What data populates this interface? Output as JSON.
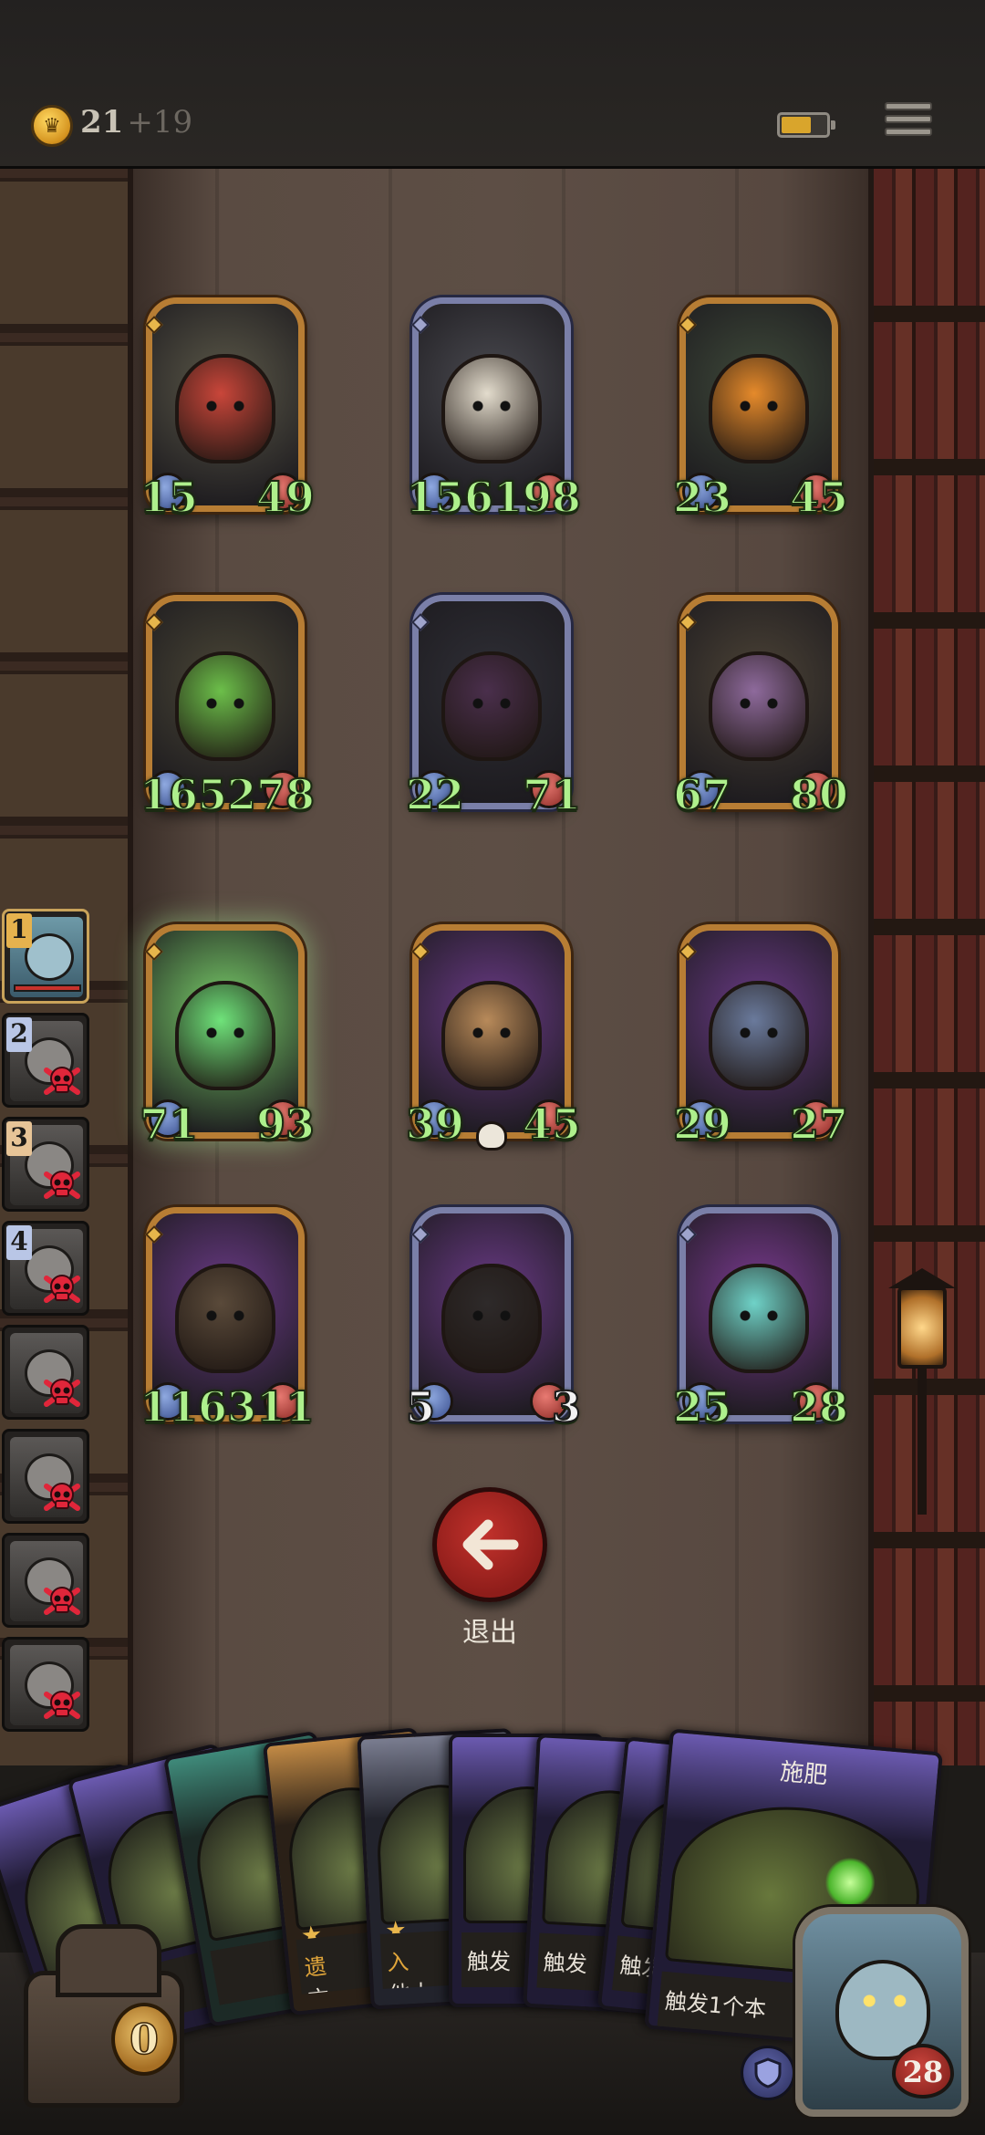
{
  "header": {
    "coins": "21",
    "coins_bonus": "+19",
    "coin_icon": "crown-coin-icon",
    "battery_icon": "battery-icon",
    "menu_icon": "hamburger-menu-icon"
  },
  "board": {
    "units": [
      {
        "id": "tomato-imp",
        "frame": "gold",
        "attack": "15",
        "health": "49",
        "color": "#c9463a",
        "bg": "#5b5848"
      },
      {
        "id": "pumpkin-scarecrow-duo",
        "frame": "silver",
        "attack": "156",
        "health": "198",
        "color": "#e3dccd",
        "bg": "#4a4a50"
      },
      {
        "id": "pumpkin-ghost",
        "frame": "gold",
        "attack": "23",
        "health": "45",
        "color": "#e58a2b",
        "bg": "#3f4a3a"
      },
      {
        "id": "leaf-girl",
        "frame": "gold",
        "attack": "165",
        "health": "278",
        "color": "#6cbf4a",
        "bg": "#4a4636"
      },
      {
        "id": "dark-flower-witch",
        "frame": "silver",
        "attack": "22",
        "health": "71",
        "color": "#4a2f4c",
        "bg": "#2f2f36"
      },
      {
        "id": "mushroom-beast",
        "frame": "gold",
        "attack": "67",
        "health": "80",
        "color": "#8e6a9c",
        "bg": "#4c4336"
      },
      {
        "id": "ghost-pirate",
        "frame": "gold",
        "attack": "71",
        "health": "93",
        "color": "#6fe37a",
        "bg": "#7ad06a",
        "glow": true
      },
      {
        "id": "scarecrow-lady",
        "frame": "gold",
        "attack": "39",
        "health": "45",
        "color": "#b88a5a",
        "bg": "#6a3a86",
        "skull": true
      },
      {
        "id": "horned-gargoyle",
        "frame": "gold",
        "attack": "29",
        "health": "27",
        "color": "#6a7a9c",
        "bg": "#6a3a86"
      },
      {
        "id": "totem-tree",
        "frame": "gold",
        "attack": "116",
        "health": "311",
        "color": "#5a4a3a",
        "bg": "#6a3a86"
      },
      {
        "id": "skull-cultist",
        "frame": "silver",
        "attack": "5",
        "health": "3",
        "color": "#2e2a2a",
        "bg": "#6a3a86",
        "white_stats": true
      },
      {
        "id": "ghost-ogre",
        "frame": "silver",
        "attack": "25",
        "health": "28",
        "color": "#6fd2c8",
        "bg": "#7a3a90"
      }
    ]
  },
  "roster": [
    {
      "num": "1",
      "num_color": "gold",
      "active": true,
      "dead": false
    },
    {
      "num": "2",
      "num_color": "blue",
      "active": false,
      "dead": true
    },
    {
      "num": "3",
      "num_color": "tan",
      "active": false,
      "dead": true
    },
    {
      "num": "4",
      "num_color": "blue",
      "active": false,
      "dead": true
    },
    {
      "num": "",
      "active": false,
      "dead": true
    },
    {
      "num": "",
      "active": false,
      "dead": true
    },
    {
      "num": "",
      "active": false,
      "dead": true
    },
    {
      "num": "",
      "active": false,
      "dead": true
    }
  ],
  "exit": {
    "label": "退出",
    "icon": "arrow-left-icon"
  },
  "hand": {
    "cards": [
      {
        "style": "violet",
        "text": ""
      },
      {
        "style": "violet",
        "text": "",
        "star": true
      },
      {
        "style": "teal",
        "text": ""
      },
      {
        "style": "tan",
        "text": "遗",
        "text2": "方",
        "gold": true,
        "star": true
      },
      {
        "style": "grey",
        "text": "入",
        "text2": "他太",
        "gold": true,
        "star": true
      },
      {
        "style": "violet",
        "text": "触发"
      },
      {
        "style": "violet",
        "text": "触发"
      },
      {
        "style": "violet",
        "text": "触发"
      }
    ],
    "featured": {
      "title": "施肥",
      "text": "触发1个本"
    }
  },
  "deck_count": "0",
  "hero": {
    "health": "28",
    "shield_icon": "shield-icon"
  }
}
